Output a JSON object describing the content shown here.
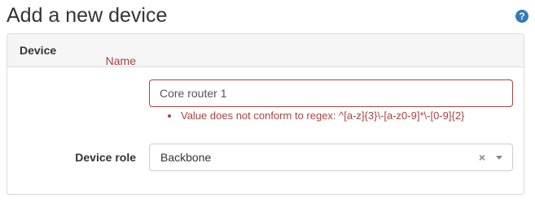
{
  "header": {
    "title": "Add a new device",
    "help_icon": "?"
  },
  "panel": {
    "title": "Device"
  },
  "form": {
    "name": {
      "label": "Name",
      "value": "Core router 1",
      "errors": [
        "Value does not conform to regex: ^[a-z]{3}\\-[a-z0-9]*\\-[0-9]{2}"
      ]
    },
    "device_role": {
      "label": "Device role",
      "selected": "Backbone",
      "clear_glyph": "×"
    }
  },
  "colors": {
    "error": "#a94442",
    "help_icon": "#337ab7",
    "panel_heading_bg": "#f5f5f5",
    "border": "#dddddd"
  },
  "icons": {
    "help": "help-icon",
    "clear": "clear-icon",
    "caret": "caret-down-icon"
  }
}
